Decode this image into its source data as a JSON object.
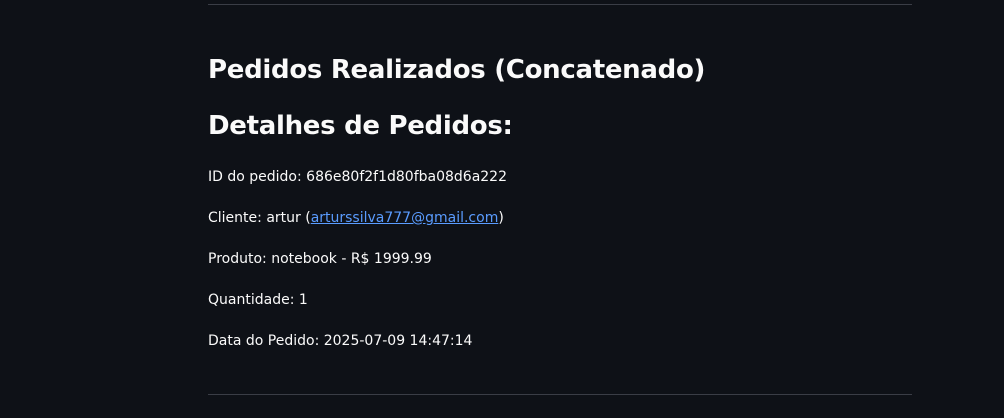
{
  "headings": {
    "section_title": "Pedidos Realizados (Concatenado)",
    "details_title": "Detalhes de Pedidos:"
  },
  "order": {
    "id_label": "ID do pedido: ",
    "id_value": "686e80f2f1d80fba08d6a222",
    "client_label": "Cliente: ",
    "client_name": "artur",
    "client_paren_open": " (",
    "client_email": "arturssilva777@gmail.com",
    "client_paren_close": ")",
    "product_label": "Produto: ",
    "product_value": "notebook - R$ 1999.99",
    "quantity_label": "Quantidade: ",
    "quantity_value": "1",
    "date_label": "Data do Pedido: ",
    "date_value": "2025-07-09 14:47:14"
  },
  "colors": {
    "background": "#0e1117",
    "text": "#fafafa",
    "link": "#5a9cff",
    "divider": "#3a3d46"
  }
}
